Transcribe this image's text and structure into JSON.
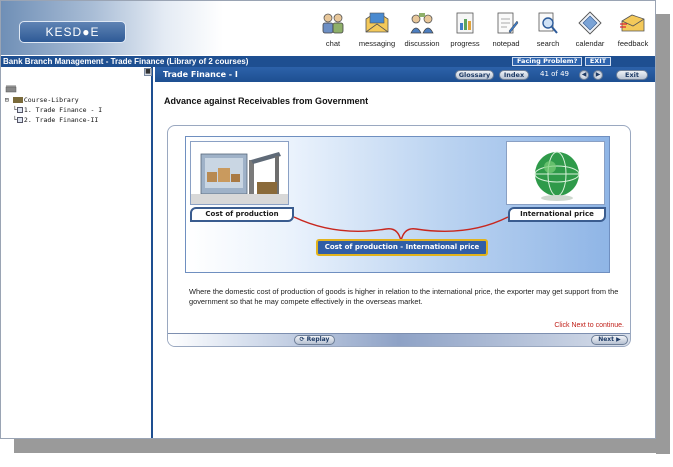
{
  "app": {
    "logo_text": "KESD●E",
    "course_title": "Bank Branch Management - Trade Finance (Library of 2 courses)",
    "facing_problem_label": "Facing Problem?",
    "exit_top_label": "EXIT"
  },
  "toolbar": [
    {
      "label": "chat",
      "icon": "chat-icon"
    },
    {
      "label": "messaging",
      "icon": "envelope-icon"
    },
    {
      "label": "discussion",
      "icon": "discussion-icon"
    },
    {
      "label": "progress",
      "icon": "progress-icon"
    },
    {
      "label": "notepad",
      "icon": "notepad-icon"
    },
    {
      "label": "search",
      "icon": "search-icon"
    },
    {
      "label": "calendar",
      "icon": "calendar-icon"
    },
    {
      "label": "feedback",
      "icon": "feedback-icon"
    }
  ],
  "sidebar": {
    "collapse_symbol": "■",
    "tree": {
      "root": "Course-Library",
      "items": [
        "1. Trade Finance - I",
        "2. Trade Finance-II"
      ]
    }
  },
  "content": {
    "module_title": "Trade Finance - I",
    "glossary_label": "Glossary",
    "index_label": "Index",
    "page_counter": "41 of 49",
    "prev_symbol": "◀",
    "next_symbol": "▶",
    "exit_label": "Exit",
    "heading": "Advance against Receivables from Government",
    "diagram": {
      "left_label": "Cost of production",
      "right_label": "International price",
      "formula_label": "Cost of production - International price"
    },
    "description": "Where the domestic cost of production of goods is higher in relation to the international price, the exporter may get support from the government so that he may compete effectively in the overseas market.",
    "next_hint": "Click Next to continue.",
    "replay_label": "Replay",
    "next_label": "Next"
  }
}
